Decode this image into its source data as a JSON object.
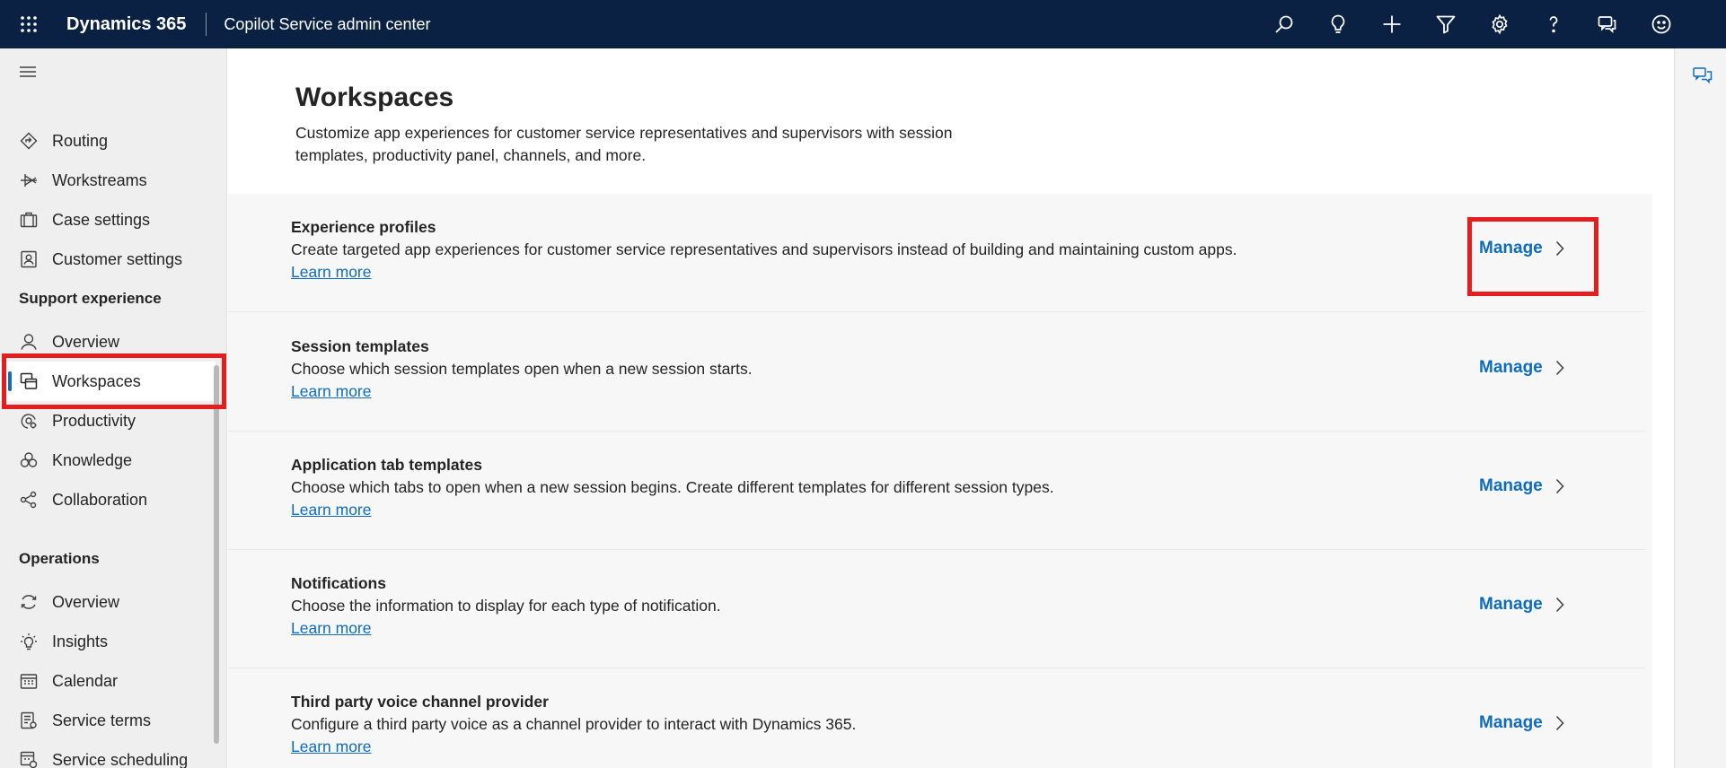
{
  "topbar": {
    "brand": "Dynamics 365",
    "app_name": "Copilot Service admin center",
    "icons": [
      "search-icon",
      "lightbulb-icon",
      "plus-icon",
      "filter-icon",
      "settings-icon",
      "help-icon",
      "feedback-icon",
      "smiley-icon"
    ]
  },
  "nav": {
    "items_top": [
      {
        "label": "Routing",
        "icon": "routing-icon"
      },
      {
        "label": "Workstreams",
        "icon": "workstreams-icon"
      },
      {
        "label": "Case settings",
        "icon": "case-settings-icon"
      },
      {
        "label": "Customer settings",
        "icon": "customer-settings-icon"
      }
    ],
    "section_support": "Support experience",
    "items_support": [
      {
        "label": "Overview",
        "icon": "overview-person-icon"
      },
      {
        "label": "Workspaces",
        "icon": "workspaces-icon",
        "selected": true
      },
      {
        "label": "Productivity",
        "icon": "productivity-icon"
      },
      {
        "label": "Knowledge",
        "icon": "knowledge-icon"
      },
      {
        "label": "Collaboration",
        "icon": "collaboration-icon"
      }
    ],
    "section_operations": "Operations",
    "items_operations": [
      {
        "label": "Overview",
        "icon": "operations-overview-icon"
      },
      {
        "label": "Insights",
        "icon": "insights-icon"
      },
      {
        "label": "Calendar",
        "icon": "calendar-icon"
      },
      {
        "label": "Service terms",
        "icon": "service-terms-icon"
      },
      {
        "label": "Service scheduling",
        "icon": "service-scheduling-icon"
      }
    ]
  },
  "page": {
    "title": "Workspaces",
    "description": "Customize app experiences for customer service representatives and supervisors with session templates, productivity panel, channels, and more."
  },
  "rows": [
    {
      "title": "Experience profiles",
      "description": "Create targeted app experiences for customer service representatives and supervisors instead of building and maintaining custom apps.",
      "link": "Learn more",
      "action": "Manage"
    },
    {
      "title": "Session templates",
      "description": "Choose which session templates open when a new session starts.",
      "link": "Learn more",
      "action": "Manage"
    },
    {
      "title": "Application tab templates",
      "description": "Choose which tabs to open when a new session begins. Create different templates for different session types.",
      "link": "Learn more",
      "action": "Manage"
    },
    {
      "title": "Notifications",
      "description": "Choose the information to display for each type of notification.",
      "link": "Learn more",
      "action": "Manage"
    },
    {
      "title": "Third party voice channel provider",
      "description": "Configure a third party voice as a channel provider to interact with Dynamics 365.",
      "link": "Learn more",
      "action": "Manage"
    }
  ],
  "colors": {
    "topbar": "#0b2143",
    "accent": "#0f6cbd",
    "highlight": "#e41e1e"
  }
}
